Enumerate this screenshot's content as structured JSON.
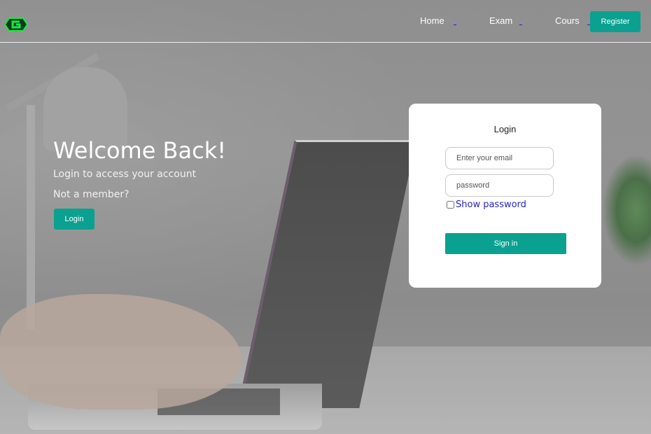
{
  "nav": {
    "links": [
      {
        "label": "Home"
      },
      {
        "label": "Exam"
      },
      {
        "label": "Cours"
      }
    ],
    "register_label": "Register",
    "logo_icon": "hexagon-g-logo-icon",
    "accent_color": "#0aa190"
  },
  "hero": {
    "title": "Welcome Back!",
    "subtitle": "Login to access your account",
    "member_text": "Not a member?",
    "login_label": "Login"
  },
  "login_card": {
    "title": "Login",
    "email_placeholder": "Enter your email",
    "password_placeholder": "password",
    "show_password_label": "Show password",
    "signin_label": "Sign in"
  }
}
